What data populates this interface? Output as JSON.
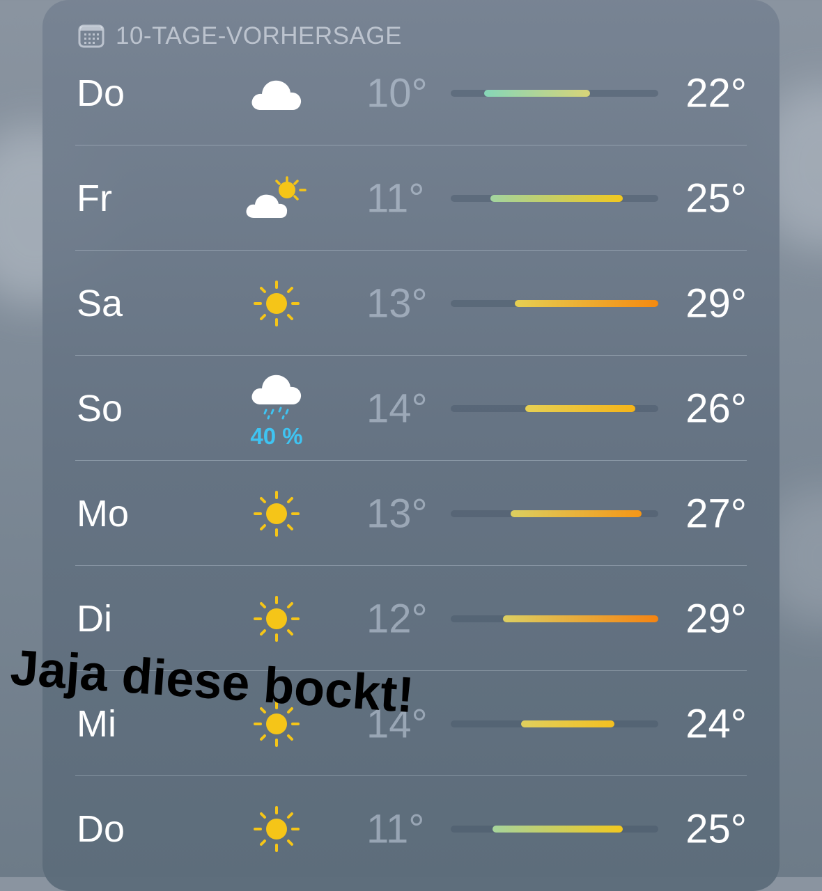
{
  "header": {
    "title": "10-TAGE-VORHERSAGE",
    "icon": "calendar-icon"
  },
  "overlay_caption": "Jaja diese bockt!",
  "days": [
    {
      "day": "Do",
      "icon": "cloud",
      "precip": "",
      "low": "10°",
      "high": "22°",
      "bar_start": 0.16,
      "bar_end": 0.67,
      "grad": [
        "#86d6b8",
        "#d8d478"
      ]
    },
    {
      "day": "Fr",
      "icon": "partly-sunny",
      "precip": "",
      "low": "11°",
      "high": "25°",
      "bar_start": 0.19,
      "bar_end": 0.83,
      "grad": [
        "#a2d4a0",
        "#f2c81e"
      ]
    },
    {
      "day": "Sa",
      "icon": "sun",
      "precip": "",
      "low": "13°",
      "high": "29°",
      "bar_start": 0.31,
      "bar_end": 1.0,
      "grad": [
        "#e6cf52",
        "#f58a10"
      ]
    },
    {
      "day": "So",
      "icon": "rain",
      "precip": "40 %",
      "low": "14°",
      "high": "26°",
      "bar_start": 0.36,
      "bar_end": 0.89,
      "grad": [
        "#e6d054",
        "#f5b418"
      ]
    },
    {
      "day": "Mo",
      "icon": "sun",
      "precip": "",
      "low": "13°",
      "high": "27°",
      "bar_start": 0.29,
      "bar_end": 0.92,
      "grad": [
        "#dccf60",
        "#f59616"
      ]
    },
    {
      "day": "Di",
      "icon": "sun",
      "precip": "",
      "low": "12°",
      "high": "29°",
      "bar_start": 0.25,
      "bar_end": 1.0,
      "grad": [
        "#dccf62",
        "#f58412"
      ]
    },
    {
      "day": "Mi",
      "icon": "sun",
      "precip": "",
      "low": "14°",
      "high": "24°",
      "bar_start": 0.34,
      "bar_end": 0.79,
      "grad": [
        "#e0cf5e",
        "#f4c020"
      ]
    },
    {
      "day": "Do",
      "icon": "sun",
      "precip": "",
      "low": "11°",
      "high": "25°",
      "bar_start": 0.2,
      "bar_end": 0.83,
      "grad": [
        "#a6d49c",
        "#f2c81e"
      ]
    }
  ]
}
